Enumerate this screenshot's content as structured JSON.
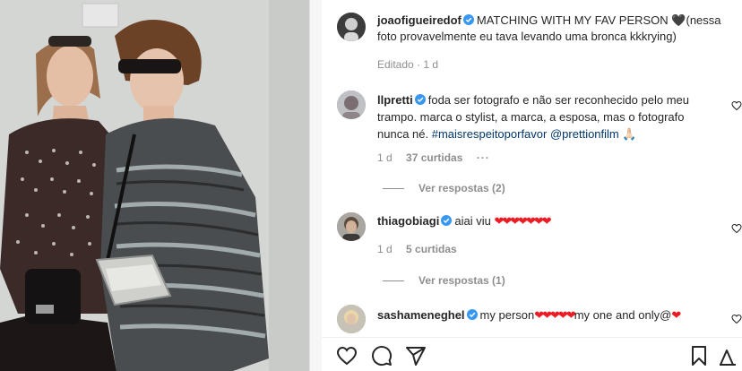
{
  "post": {
    "author": "joaofigueiredof",
    "caption_line1": "MATCHING WITH MY FAV PERSON",
    "caption_line2": "(nessa",
    "caption_line3": "foto provavelmente eu tava levando uma bronca kkkrying)",
    "edited_label": "Editado · 1 d"
  },
  "comments": [
    {
      "user": "llpretti",
      "text_line1": "foda ser fotografo e não ser reconhecido pelo meu",
      "text_line2": "trampo. marca o stylist, a marca, a esposa, mas o fotografo",
      "text_line3a": "nunca né.",
      "hashtag": "#maisrespeitoporfavor",
      "mention": "@prettionfilm",
      "emoji": "🙏🏻",
      "time": "1 d",
      "likes": "37 curtidas",
      "more": "···",
      "replies_label": "Ver respostas (2)"
    },
    {
      "user": "thiagobiagi",
      "text": "aiai viu",
      "hearts": "❤❤❤❤❤❤❤",
      "time": "1 d",
      "likes": "5 curtidas",
      "replies_label": "Ver respostas (1)"
    },
    {
      "user": "sashameneghel",
      "text_a": "my person",
      "hearts_a": "❤❤❤❤❤",
      "text_b": "my one and only@",
      "hearts_b": "❤"
    }
  ],
  "icons": {
    "verified": "verified-badge-icon",
    "heart": "heart-icon",
    "comment": "comment-icon",
    "share": "paper-plane-icon",
    "save": "bookmark-icon",
    "options": "more-options-icon"
  },
  "colors": {
    "verified_blue": "#3897f0",
    "link": "#00376b",
    "muted": "#8e8e8e",
    "heart_red": "#ed1c24"
  }
}
